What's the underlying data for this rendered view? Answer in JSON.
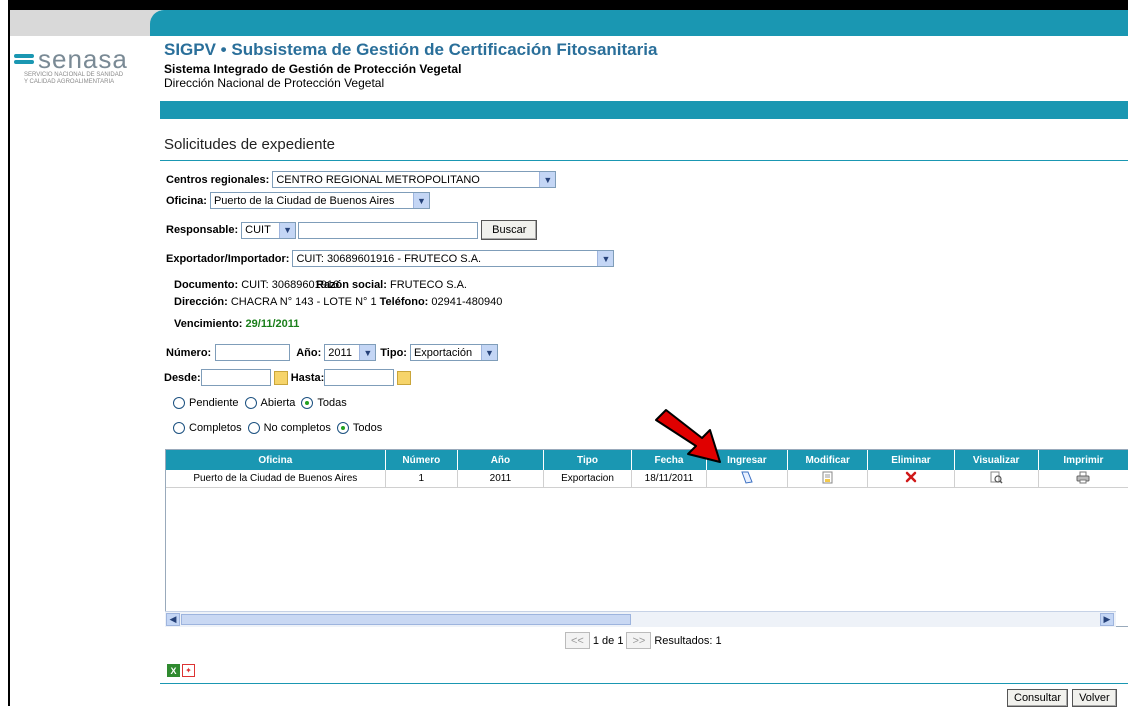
{
  "logo": {
    "name": "senasa",
    "subtitle_line1": "SERVICIO NACIONAL DE SANIDAD",
    "subtitle_line2": "Y CALIDAD AGROALIMENTARIA"
  },
  "header": {
    "title": "SIGPV • Subsistema de Gestión de Certificación Fitosanitaria",
    "subtitle1": "Sistema Integrado de Gestión de Protección Vegetal",
    "subtitle2": "Dirección Nacional de Protección Vegetal"
  },
  "page_title": "Solicitudes de expediente",
  "form": {
    "centros_label": "Centros regionales:",
    "centros_value": "CENTRO REGIONAL METROPOLITANO",
    "oficina_label": "Oficina:",
    "oficina_value": "Puerto de la Ciudad de Buenos Aires",
    "responsable_label": "Responsable:",
    "responsable_type": "CUIT",
    "responsable_value": "",
    "buscar_label": "Buscar",
    "exportador_label": "Exportador/Importador:",
    "exportador_value": "CUIT: 30689601916 - FRUTECO S.A.",
    "numero_label": "Número:",
    "numero_value": "",
    "anio_label": "Año:",
    "anio_value": "2011",
    "tipo_label": "Tipo:",
    "tipo_value": "Exportación",
    "desde_label": "Desde:",
    "hasta_label": "Hasta:",
    "estado_options": [
      "Pendiente",
      "Abierta",
      "Todas"
    ],
    "estado_selected": "Todas",
    "completitud_options": [
      "Completos",
      "No completos",
      "Todos"
    ],
    "completitud_selected": "Todos"
  },
  "info": {
    "documento_label": "Documento:",
    "documento_value": "CUIT: 30689601916",
    "razon_label": "Razón social:",
    "razon_value": "FRUTECO S.A.",
    "direccion_label": "Dirección:",
    "direccion_value": "CHACRA N° 143 - LOTE N° 1",
    "telefono_label": "Teléfono:",
    "telefono_value": "02941-480940",
    "vencimiento_label": "Vencimiento:",
    "vencimiento_value": "29/11/2011"
  },
  "table": {
    "headers": [
      "Oficina",
      "Número",
      "Año",
      "Tipo",
      "Fecha",
      "Ingresar",
      "Modificar",
      "Eliminar",
      "Visualizar",
      "Imprimir"
    ],
    "rows": [
      {
        "oficina": "Puerto de la Ciudad de Buenos Aires",
        "numero": "1",
        "anio": "2011",
        "tipo": "Exportacion",
        "fecha": "18/11/2011"
      }
    ]
  },
  "pager": {
    "prev": "<<",
    "page_text": "1 de 1",
    "next": ">>",
    "results": "Resultados: 1"
  },
  "footer": {
    "consultar_label": "Consultar",
    "volver_label": "Volver"
  },
  "colors": {
    "accent": "#1a97b2",
    "title": "#2a6f9a",
    "green": "#1a7f1a",
    "arrow": "#e00000"
  }
}
